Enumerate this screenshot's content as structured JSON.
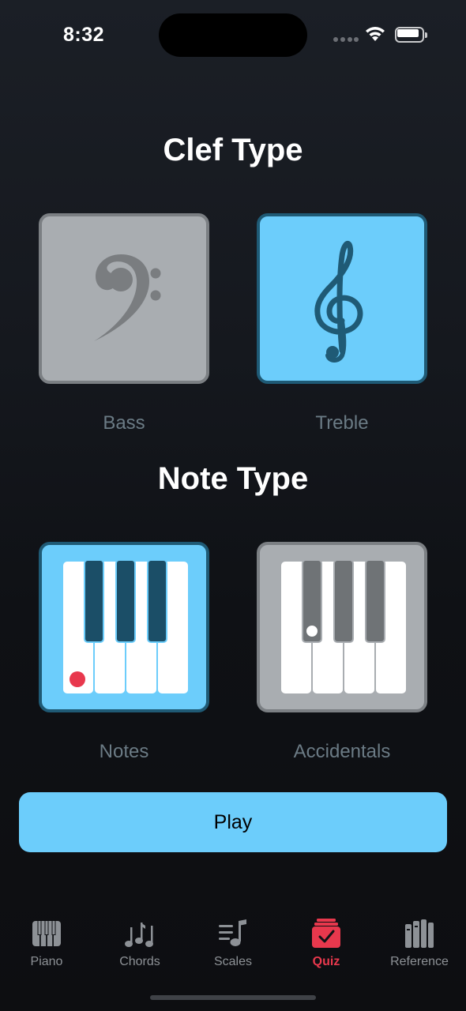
{
  "status": {
    "time": "8:32"
  },
  "clef_section": {
    "title": "Clef Type",
    "options": [
      {
        "label": "Bass",
        "icon": "bass-clef-icon",
        "selected": false
      },
      {
        "label": "Treble",
        "icon": "treble-clef-icon",
        "selected": true
      }
    ]
  },
  "note_section": {
    "title": "Note Type",
    "options": [
      {
        "label": "Notes",
        "icon": "piano-keys-icon",
        "selected": true
      },
      {
        "label": "Accidentals",
        "icon": "piano-accidentals-icon",
        "selected": false
      }
    ]
  },
  "play_button": {
    "label": "Play"
  },
  "tabs": [
    {
      "label": "Piano",
      "icon": "piano-icon",
      "active": false
    },
    {
      "label": "Chords",
      "icon": "chords-icon",
      "active": false
    },
    {
      "label": "Scales",
      "icon": "scales-icon",
      "active": false
    },
    {
      "label": "Quiz",
      "icon": "quiz-icon",
      "active": true
    },
    {
      "label": "Reference",
      "icon": "reference-icon",
      "active": false
    }
  ],
  "colors": {
    "accent": "#6ccdfb",
    "selected_border": "#1f5a75",
    "unselected_tile": "#a9adb1",
    "active_tab": "#e8384d",
    "inactive_tab": "#8d9196"
  }
}
